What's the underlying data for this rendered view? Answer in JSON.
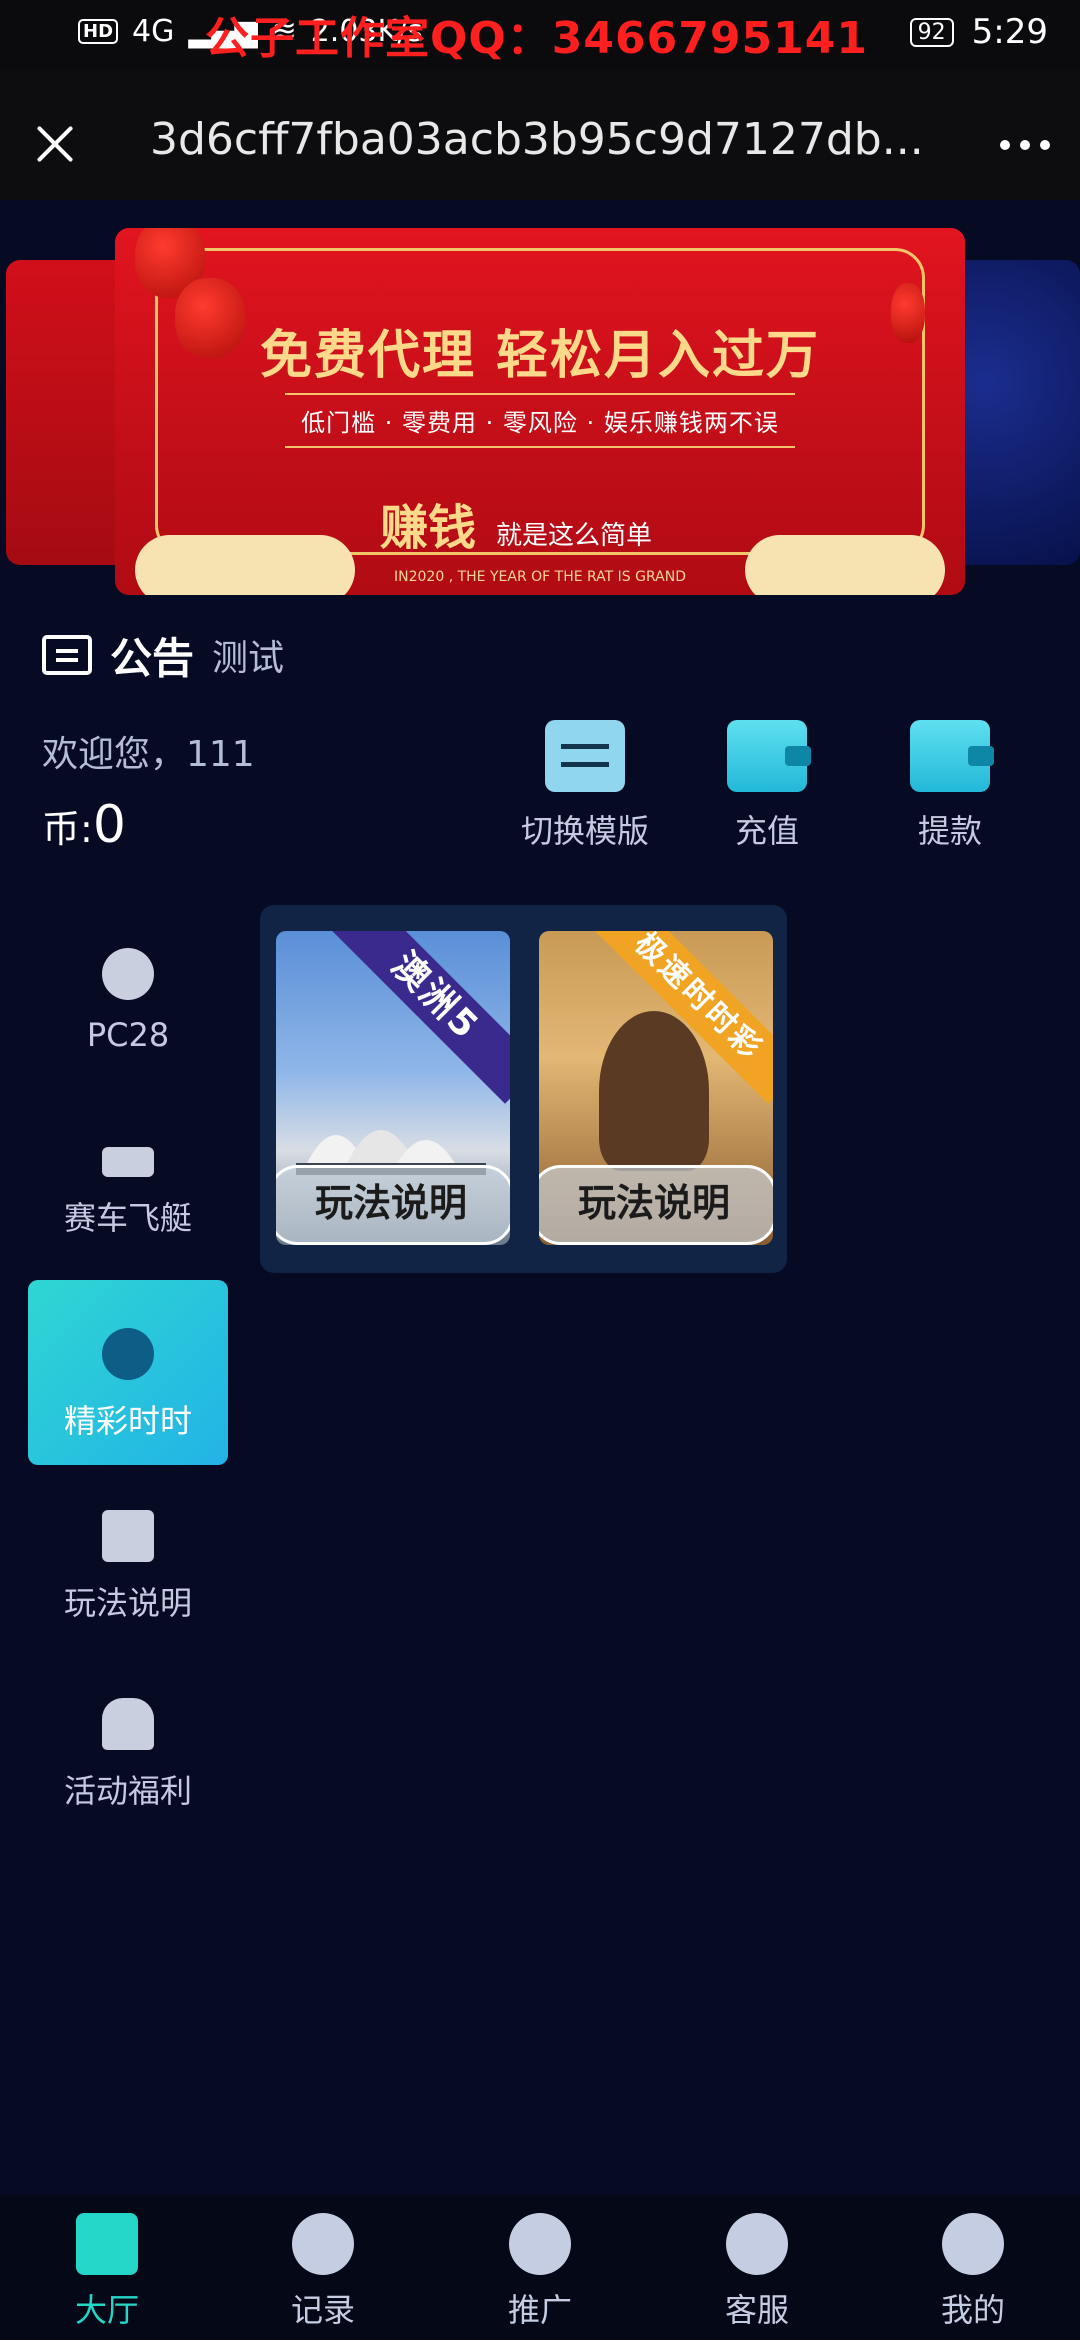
{
  "status_bar": {
    "network": "4G",
    "speed": "2.03K/s",
    "overlay_text": "公子工作室QQ：3466795141",
    "battery": "92",
    "time": "5:29"
  },
  "title_bar": {
    "title": "3d6cff7fba03acb3b95c9d7127db..."
  },
  "banner": {
    "headline": "免费代理  轻松月入过万",
    "subline": "低门槛 · 零费用 · 零风险 · 娱乐赚钱两不误",
    "slogan_big": "赚钱",
    "slogan_small": "就是这么简单",
    "footer": "IN2020 , THE YEAR OF THE RAT IS GRAND",
    "active_dot": 2,
    "dot_count": 4
  },
  "notice": {
    "label": "公告",
    "text": "测试"
  },
  "account": {
    "welcome": "欢迎您，111",
    "coin_label": "币:",
    "coin_value": "0"
  },
  "actions": [
    {
      "label": "切换模版",
      "icon": "switch-icon"
    },
    {
      "label": "充值",
      "icon": "wallet-icon"
    },
    {
      "label": "提款",
      "icon": "wallet-icon"
    }
  ],
  "sidebar": [
    {
      "label": "PC28",
      "icon": "eight-ball-icon",
      "active": false
    },
    {
      "label": "赛车飞艇",
      "icon": "boat-icon",
      "active": false
    },
    {
      "label": "精彩时时",
      "icon": "ssc-icon",
      "active": true
    },
    {
      "label": "玩法说明",
      "icon": "cards-icon",
      "active": false
    },
    {
      "label": "活动福利",
      "icon": "gift-icon",
      "active": false
    }
  ],
  "games": [
    {
      "ribbon": "澳洲5",
      "button": "玩法说明"
    },
    {
      "ribbon": "极速时时彩",
      "button": "玩法说明"
    }
  ],
  "tabs": [
    {
      "label": "大厅",
      "icon": "home-icon",
      "active": true
    },
    {
      "label": "记录",
      "icon": "footprint-icon",
      "active": false
    },
    {
      "label": "推广",
      "icon": "paper-plane-icon",
      "active": false
    },
    {
      "label": "客服",
      "icon": "headset-icon",
      "active": false
    },
    {
      "label": "我的",
      "icon": "user-icon",
      "active": false
    }
  ]
}
